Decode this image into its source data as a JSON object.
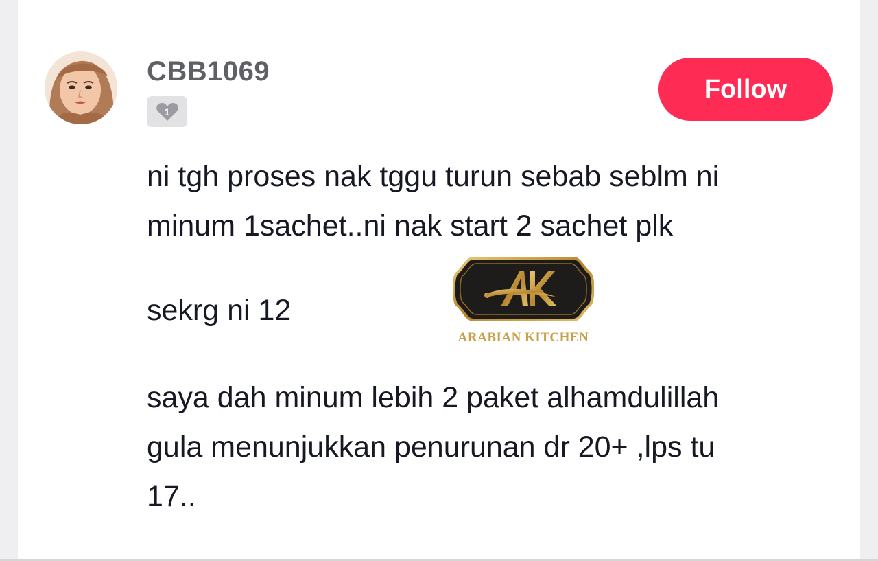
{
  "user": {
    "username": "CBB1069",
    "level": "1"
  },
  "follow_button": {
    "label": "Follow"
  },
  "comment": {
    "paragraph1": "ni tgh proses nak tggu turun sebab seblm ni\nminum 1sachet..ni nak start 2 sachet plk",
    "paragraph2": "sekrg ni 12",
    "paragraph3": "saya dah minum lebih 2 paket alhamdulillah\ngula menunjukkan penurunan dr 20+ ,lps tu\n17.."
  },
  "watermark": {
    "brand": "ARABIAN KITCHEN",
    "monogram": "AK"
  },
  "colors": {
    "accent": "#fe2c55",
    "text": "#161823",
    "username": "#5f5f66",
    "watermark_gold": "#c9a04a"
  },
  "icons": {
    "avatar": "user-avatar-illustration",
    "badge": "level-badge-icon"
  }
}
